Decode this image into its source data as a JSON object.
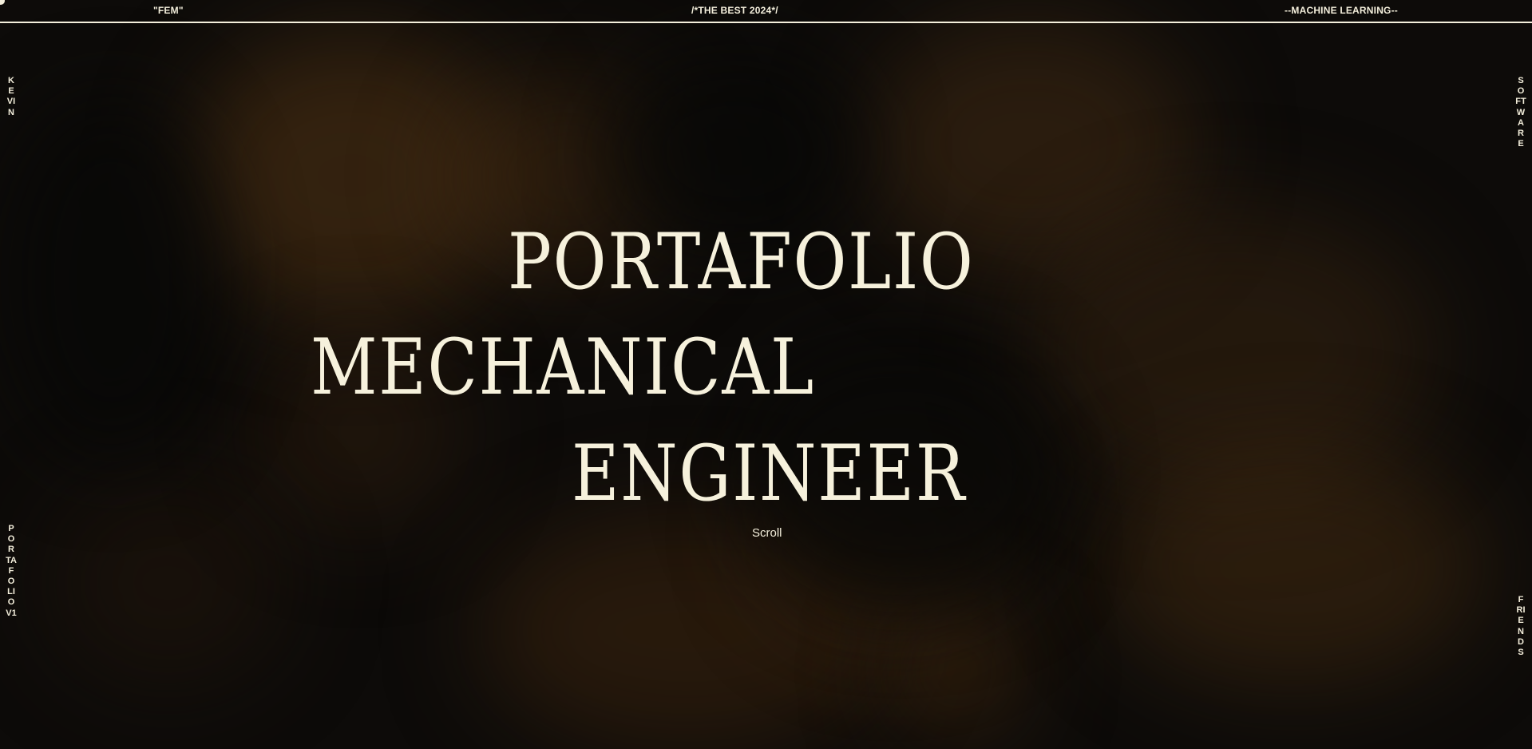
{
  "topbar": {
    "left": "\"FEM\"",
    "center": "/*THE BEST 2024*/",
    "right": "--MACHINE LEARNING--"
  },
  "side": {
    "left_top": "KEVIN",
    "left_bottom": "PORTAFOLIO V1",
    "right_top": "SOFTWARE",
    "right_bottom": "FRIENDS"
  },
  "hero": {
    "line1": "PORTAFOLIO",
    "line2": "MECHANICAL",
    "line3": "ENGINEER"
  },
  "scroll_label": "Scroll",
  "colors": {
    "background": "#0e0c0a",
    "text": "#f4efdc",
    "accent_glow": "#54341a"
  }
}
